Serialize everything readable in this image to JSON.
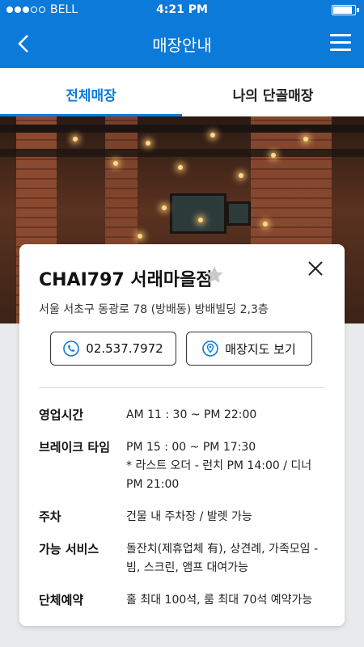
{
  "status_bar": {
    "carrier": "BELL",
    "time": "4:21 PM",
    "battery_level": 0.9
  },
  "nav": {
    "title": "매장안내",
    "back_icon": "chevron-left-icon",
    "menu_icon": "hamburger-menu-icon"
  },
  "tabs": [
    {
      "label": "전체매장",
      "active": true
    },
    {
      "label": "나의 단골매장",
      "active": false
    }
  ],
  "store": {
    "name": "CHAI797 서래마을점",
    "address": "서울 서초구 동광로 78 (방배동) 방배빌딩 2,3층",
    "phone_button": "02.537.7972",
    "map_button": "매장지도 보기",
    "info": [
      {
        "label": "영업시간",
        "lines": [
          "AM 11 : 30 ~ PM 22:00"
        ]
      },
      {
        "label": "브레이크 타임",
        "lines": [
          "PM 15 : 00 ~ PM 17:30",
          "* 라스트 오더 - 런치 PM 14:00 / 디너",
          "PM 21:00"
        ]
      },
      {
        "label": "주차",
        "lines": [
          "건물 내 주차장 / 발렛 가능"
        ]
      },
      {
        "label": "가능 서비스",
        "lines": [
          "돌잔치(제휴업체 有), 상견례, 가족모임 -",
          "빔, 스크린, 앰프 대여가능"
        ]
      },
      {
        "label": "단체예약",
        "lines": [
          "홀 최대 100석, 룸 최대 70석 예약가능"
        ]
      }
    ]
  },
  "colors": {
    "brand": "#0b7ad8"
  }
}
